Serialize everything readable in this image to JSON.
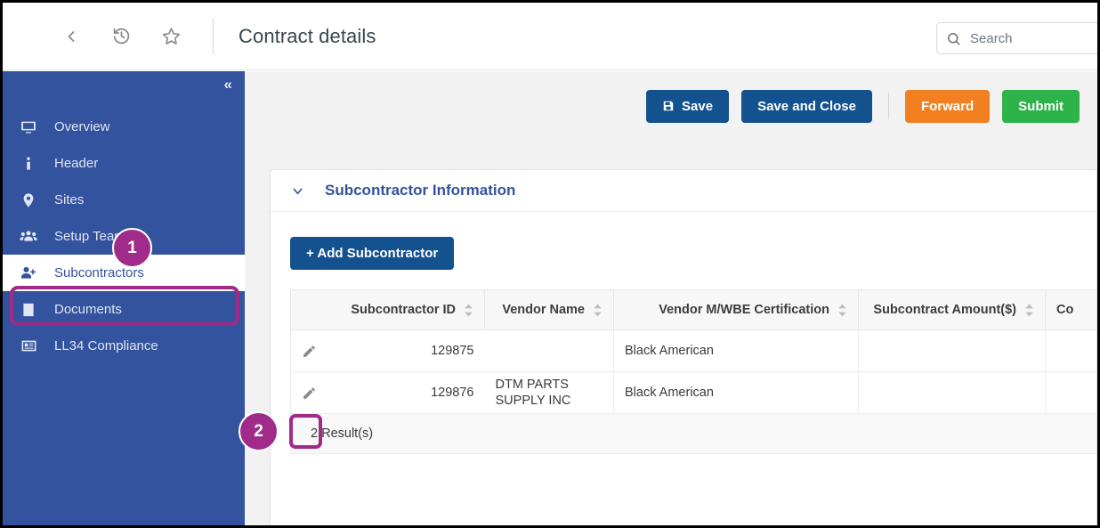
{
  "topbar": {
    "back_icon": "chevron-left-icon",
    "history_icon": "history-clock-icon",
    "favorite_icon": "star-icon",
    "title": "Contract details",
    "search": {
      "icon": "search-icon",
      "placeholder": "Search",
      "value": ""
    }
  },
  "sidebar": {
    "collapse_label": "«",
    "items": [
      {
        "label": "Overview",
        "icon": "monitor-icon",
        "active": false
      },
      {
        "label": "Header",
        "icon": "info-icon",
        "active": false
      },
      {
        "label": "Sites",
        "icon": "map-pin-icon",
        "active": false
      },
      {
        "label": "Setup Team",
        "icon": "users-icon",
        "active": false
      },
      {
        "label": "Subcontractors",
        "icon": "user-plus-icon",
        "active": true
      },
      {
        "label": "Documents",
        "icon": "book-icon",
        "active": false
      },
      {
        "label": "LL34 Compliance",
        "icon": "id-card-icon",
        "active": false
      }
    ]
  },
  "toolbar": {
    "save_label": "Save",
    "save_icon": "floppy-disk-icon",
    "save_close_label": "Save and Close",
    "forward_label": "Forward",
    "submit_label": "Submit"
  },
  "card": {
    "section_title": "Subcontractor Information",
    "section_chevron": "chevron-down-icon",
    "add_button_label": "+ Add Subcontractor",
    "table": {
      "columns": [
        "Subcontractor ID",
        "Vendor Name",
        "Vendor M/WBE Certification",
        "Subcontract Amount($)",
        "Co"
      ],
      "rows": [
        {
          "edit_icon": "pencil-icon",
          "subcontractor_id": "129875",
          "vendor_name": "",
          "certification": "Black American",
          "amount": "",
          "co": ""
        },
        {
          "edit_icon": "pencil-icon",
          "subcontractor_id": "129876",
          "vendor_name": "DTM PARTS SUPPLY INC",
          "certification": "Black American",
          "amount": "",
          "co": ""
        }
      ],
      "results_label": "2 Result(s)"
    }
  },
  "annotations": {
    "color": "#a02b8a",
    "badge_1": "1",
    "badge_2": "2"
  },
  "colors": {
    "sidebar_blue": "#33539e",
    "primary_blue": "#14518f",
    "forward_orange": "#f28020",
    "submit_green": "#2eb34a",
    "annotation_magenta": "#a02b8a"
  }
}
